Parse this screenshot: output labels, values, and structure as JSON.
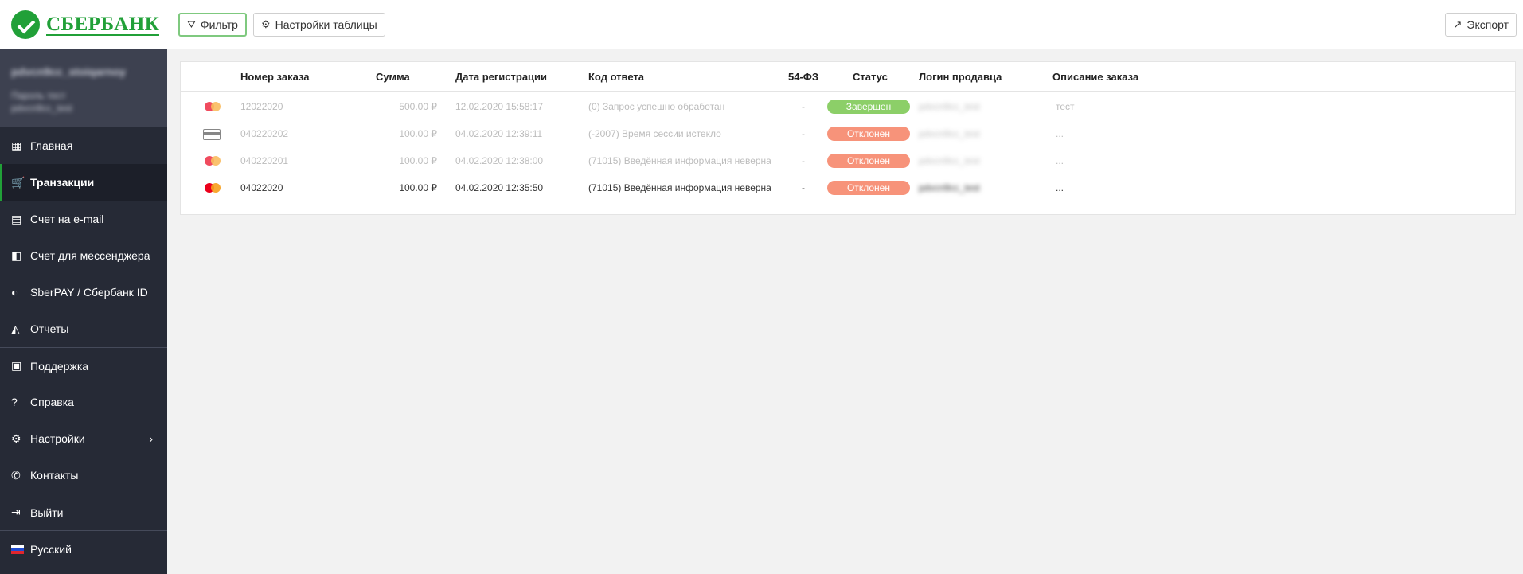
{
  "brand": {
    "name": "СБЕРБАНК",
    "color": "#21a038"
  },
  "user": {
    "name": "pdvcn9cc_stoiqarnoy",
    "line1": "Пароль тест",
    "line2": "pdvcn9cc_test"
  },
  "sidebar": {
    "items": [
      {
        "label": "Главная",
        "icon": "dashboard-icon"
      },
      {
        "label": "Транзакции",
        "icon": "cart-icon"
      },
      {
        "label": "Счет на e-mail",
        "icon": "document-icon"
      },
      {
        "label": "Счет для мессенджера",
        "icon": "messenger-invoice-icon"
      },
      {
        "label": "SberPAY / Сбербанк ID",
        "icon": "sberpay-icon"
      },
      {
        "label": "Отчеты",
        "icon": "chart-icon"
      },
      {
        "label": "Поддержка",
        "icon": "chat-icon"
      },
      {
        "label": "Справка",
        "icon": "help-icon"
      },
      {
        "label": "Настройки",
        "icon": "gear-icon"
      },
      {
        "label": "Контакты",
        "icon": "phone-icon"
      },
      {
        "label": "Выйти",
        "icon": "logout-icon"
      },
      {
        "label": "Русский",
        "icon": "russia-flag-icon"
      }
    ]
  },
  "toolbar": {
    "filter_label": "Фильтр",
    "settings_label": "Настройки таблицы",
    "export_label": "Экспорт"
  },
  "table": {
    "headers": [
      "Номер заказа",
      "Сумма",
      "Дата регистрации",
      "Код ответа",
      "54-ФЗ",
      "Статус",
      "Логин продавца",
      "Описание заказа"
    ],
    "rows": [
      {
        "payment": "mastercard",
        "order": "12022020",
        "amount": "500.00 ₽",
        "date": "12.02.2020 15:58:17",
        "response": "(0) Запрос успешно обработан",
        "fz54": "-",
        "status": "Завершен",
        "status_color": "#8ccf68",
        "login": "pdvcn9cc_test",
        "description": "тест"
      },
      {
        "payment": "card",
        "order": "040220202",
        "amount": "100.00 ₽",
        "date": "04.02.2020 12:39:11",
        "response": "(-2007) Время сессии истекло",
        "fz54": "-",
        "status": "Отклонен",
        "status_color": "#f7937a",
        "login": "pdvcn9cc_test",
        "description": "..."
      },
      {
        "payment": "mastercard",
        "order": "040220201",
        "amount": "100.00 ₽",
        "date": "04.02.2020 12:38:00",
        "response": "(71015) Введённая информация неверна",
        "fz54": "-",
        "status": "Отклонен",
        "status_color": "#f7937a",
        "login": "pdvcn9cc_test",
        "description": "..."
      },
      {
        "payment": "mastercard",
        "order": "04022020",
        "amount": "100.00 ₽",
        "date": "04.02.2020 12:35:50",
        "response": "(71015) Введённая информация неверна",
        "fz54": "-",
        "status": "Отклонен",
        "status_color": "#f7937a",
        "login": "pdvcn9cc_test",
        "description": "..."
      }
    ]
  }
}
